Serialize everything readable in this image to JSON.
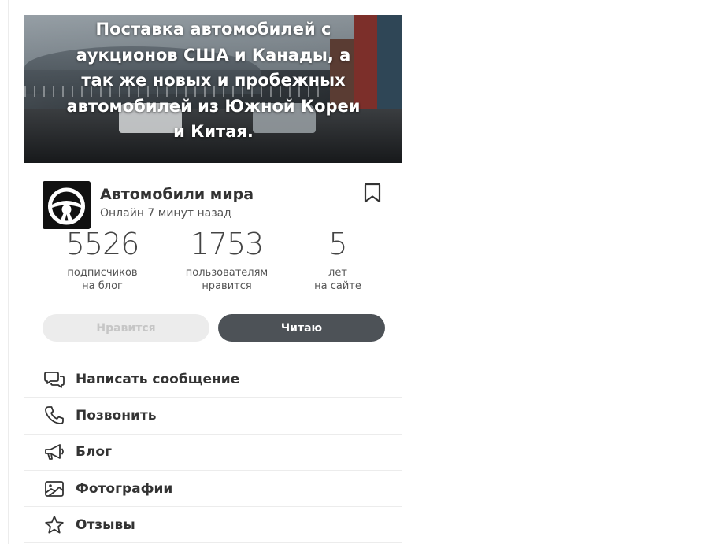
{
  "banner": {
    "text": "Поставка автомобилей с\nаукционов США и Канады, а\nтак же новых и пробежных\nавтомобилей из Южной Кореи\nи Китая."
  },
  "profile": {
    "name": "Автомобили мира",
    "status": "Онлайн 7 минут назад"
  },
  "stats": [
    {
      "value": "5526",
      "label": "подписчиков\nна блог"
    },
    {
      "value": "1753",
      "label": "пользователям\nнравится"
    },
    {
      "value": "5",
      "label": "лет\nна сайте"
    }
  ],
  "buttons": {
    "like": "Нравится",
    "read": "Читаю"
  },
  "menu": [
    {
      "label": "Написать сообщение",
      "icon": "chat-icon"
    },
    {
      "label": "Позвонить",
      "icon": "phone-icon"
    },
    {
      "label": "Блог",
      "icon": "megaphone-icon"
    },
    {
      "label": "Фотографии",
      "icon": "photo-icon"
    },
    {
      "label": "Отзывы",
      "icon": "star-icon"
    }
  ],
  "colors": {
    "primary_button": "#4d5257",
    "disabled_button": "#ececec"
  }
}
